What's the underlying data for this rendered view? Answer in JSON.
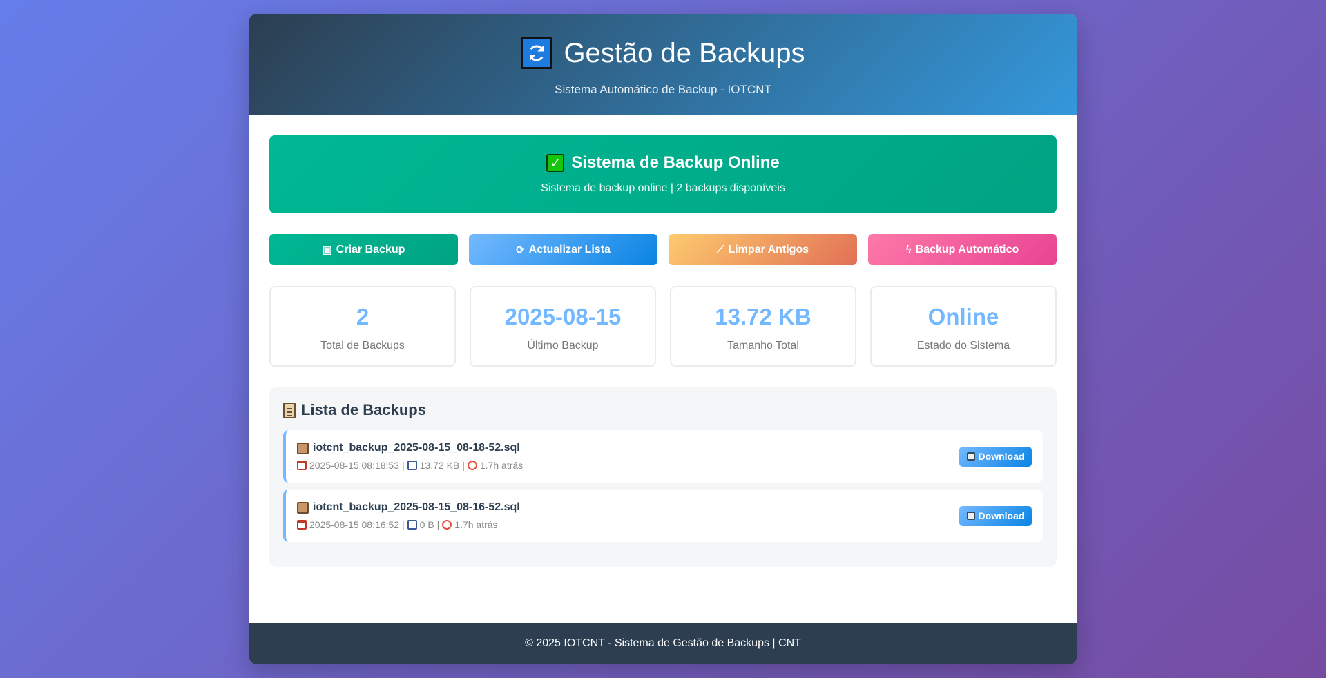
{
  "header": {
    "title": "Gestão de Backups",
    "subtitle": "Sistema Automático de Backup - IOTCNT",
    "icon": "refresh-icon"
  },
  "status": {
    "icon": "check-icon",
    "title": "Sistema de Backup Online",
    "message": "Sistema de backup online | 2 backups disponíveis"
  },
  "actions": [
    {
      "label": "Criar Backup",
      "icon": "package-icon",
      "color": "#00b894"
    },
    {
      "label": "Actualizar Lista",
      "icon": "refresh-icon",
      "color": "#0984e3"
    },
    {
      "label": "Limpar Antigos",
      "icon": "broom-icon",
      "color": "#e17055"
    },
    {
      "label": "Backup Automático",
      "icon": "lightning-icon",
      "color": "#e84393"
    }
  ],
  "stats": [
    {
      "value": "2",
      "label": "Total de Backups"
    },
    {
      "value": "2025-08-15",
      "label": "Último Backup"
    },
    {
      "value": "13.72 KB",
      "label": "Tamanho Total"
    },
    {
      "value": "Online",
      "label": "Estado do Sistema"
    }
  ],
  "backup_list": {
    "title": "Lista de Backups",
    "icon": "clipboard-icon",
    "items": [
      {
        "filename": "iotcnt_backup_2025-08-15_08-18-52.sql",
        "date": "2025-08-15 08:18:53",
        "size": "13.72 KB",
        "age": "1.7h atrás",
        "download_label": "Download"
      },
      {
        "filename": "iotcnt_backup_2025-08-15_08-16-52.sql",
        "date": "2025-08-15 08:16:52",
        "size": "0 B",
        "age": "1.7h atrás",
        "download_label": "Download"
      }
    ]
  },
  "footer": {
    "text": "© 2025 IOTCNT - Sistema de Gestão de Backups | CNT"
  },
  "colors": {
    "accent": "#74b9ff",
    "header_dark": "#2c3e50",
    "success": "#00b894"
  }
}
